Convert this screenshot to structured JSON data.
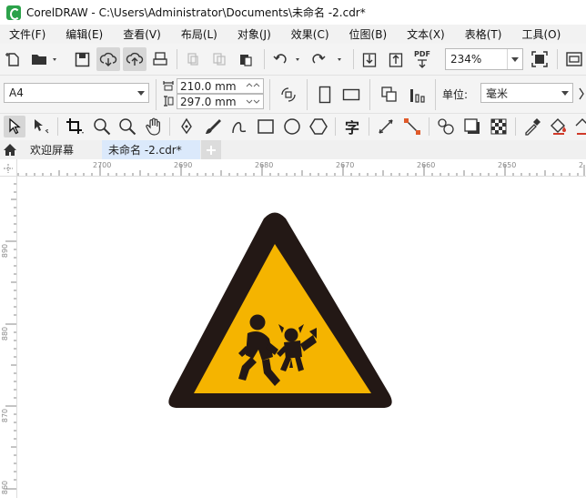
{
  "window": {
    "title": "CorelDRAW - C:\\Users\\Administrator\\Documents\\未命名 -2.cdr*"
  },
  "menu": [
    {
      "label": "文件(F)"
    },
    {
      "label": "编辑(E)"
    },
    {
      "label": "查看(V)"
    },
    {
      "label": "布局(L)"
    },
    {
      "label": "对象(J)"
    },
    {
      "label": "效果(C)"
    },
    {
      "label": "位图(B)"
    },
    {
      "label": "文本(X)"
    },
    {
      "label": "表格(T)"
    },
    {
      "label": "工具(O)"
    }
  ],
  "toolbar": {
    "zoom_value": "234%",
    "pdf_label": "PDF"
  },
  "property_bar": {
    "page_size": "A4",
    "width": "210.0 mm",
    "height": "297.0 mm",
    "unit_label": "单位:",
    "unit_value": "毫米"
  },
  "toolbox": {
    "text_tool_glyph": "字"
  },
  "tabs": [
    {
      "label": "欢迎屏幕",
      "active": false
    },
    {
      "label": "未命名 -2.cdr*",
      "active": true
    }
  ],
  "ruler": {
    "horizontal": [
      "2700",
      "2690",
      "2680",
      "2670",
      "2660",
      "2650",
      "2"
    ],
    "vertical": [
      "890",
      "880",
      "870",
      "860"
    ]
  },
  "colors": {
    "sign_border": "#231815",
    "sign_fill": "#f5b400",
    "accent": "#2ca24a"
  }
}
